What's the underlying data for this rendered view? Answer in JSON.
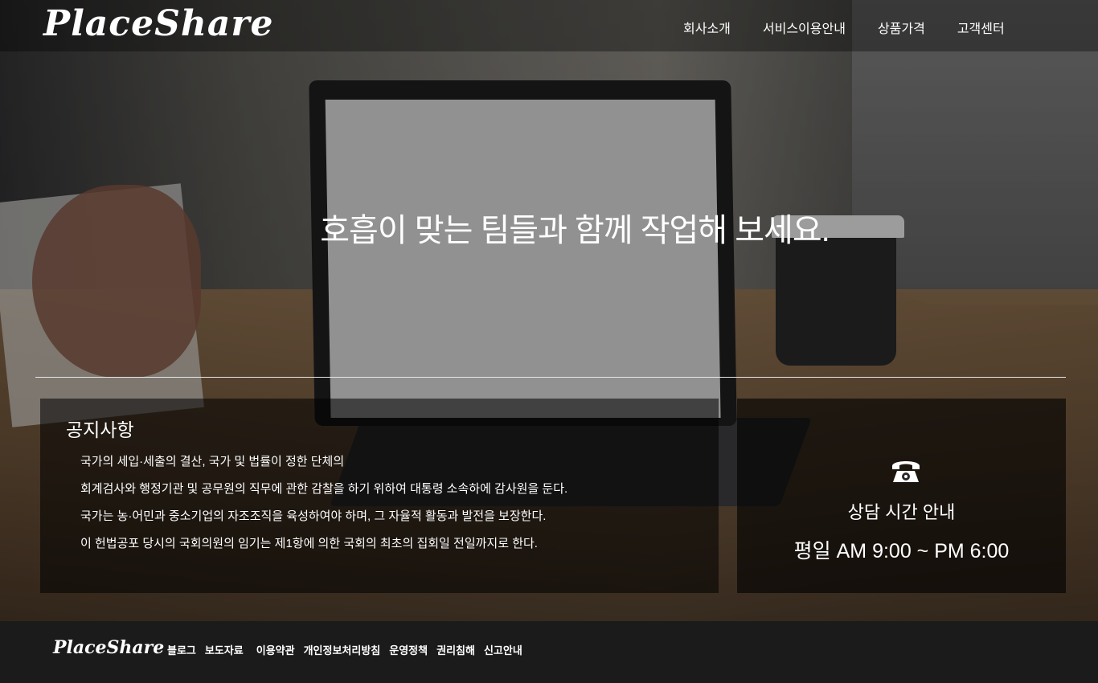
{
  "header": {
    "logo": "PlaceShare",
    "nav": [
      "회사소개",
      "서비스이용안내",
      "상품가격",
      "고객센터"
    ]
  },
  "hero": {
    "headline": "호흡이 맞는 팀들과 함께 작업해 보세요."
  },
  "notice": {
    "title": "공지사항",
    "items": [
      "국가의 세입·세출의 결산, 국가 및 법률이 정한 단체의",
      "회계검사와 행정기관 및 공무원의 직무에 관한 감찰을 하기 위하여 대통령 소속하에 감사원을 둔다.",
      "국가는 농·어민과 중소기업의 자조조직을 육성하여야 하며, 그 자율적 활동과 발전을 보장한다.",
      "이 헌법공포 당시의 국회의원의 임기는 제1항에 의한 국회의 최초의 집회일 전일까지로 한다."
    ]
  },
  "contact": {
    "icon": "phone-icon",
    "title": "상담 시간 안내",
    "hours": "평일 AM 9:00 ~ PM 6:00"
  },
  "footer": {
    "logo": "PlaceShare",
    "links": [
      "블로그",
      "보도자료",
      "이용약관",
      "개인정보처리방침",
      "운영정책",
      "권리침해",
      "신고안내"
    ]
  }
}
